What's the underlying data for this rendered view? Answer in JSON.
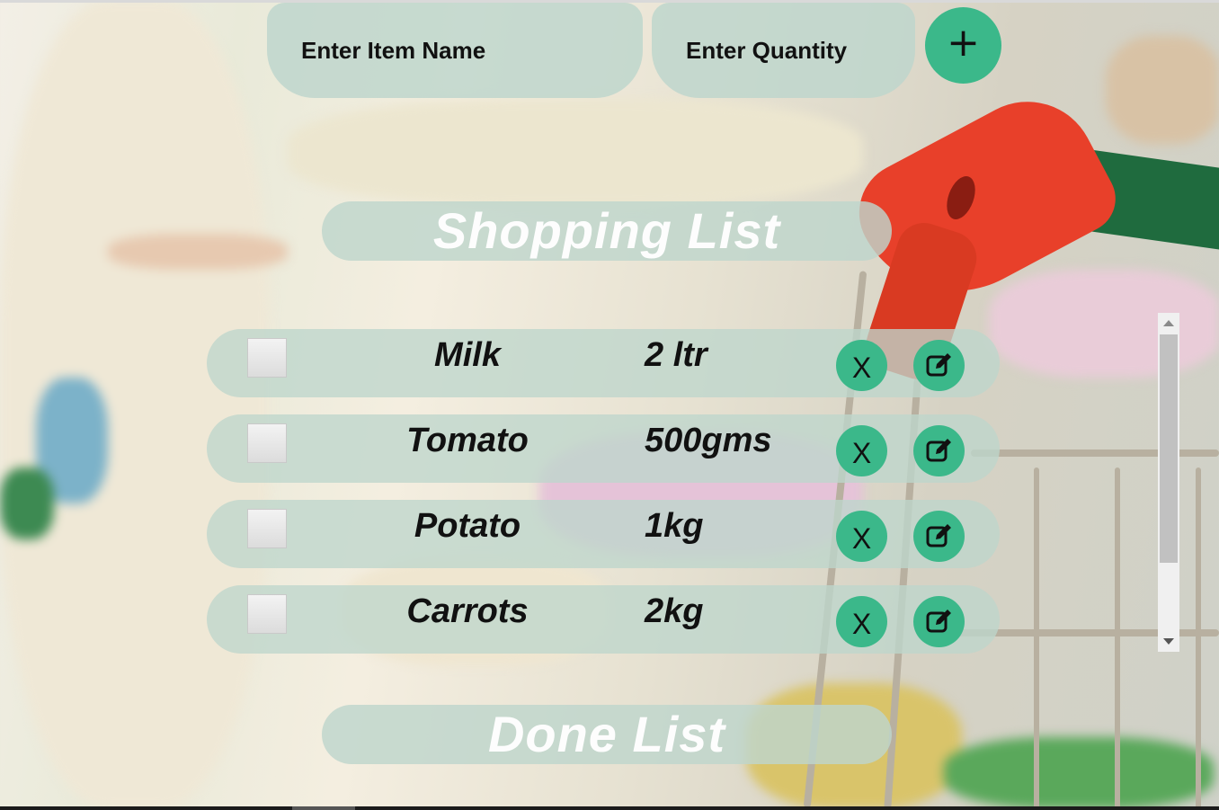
{
  "inputs": {
    "item_name_placeholder": "Enter Item Name",
    "quantity_placeholder": "Enter Quantity",
    "add_label": "+"
  },
  "shopping_title": "Shopping List",
  "done_title": "Done List",
  "items": [
    {
      "name": "Milk",
      "qty": "2 ltr",
      "checked": false
    },
    {
      "name": "Tomato",
      "qty": "500gms",
      "checked": false
    },
    {
      "name": "Potato",
      "qty": "1kg",
      "checked": false
    },
    {
      "name": "Carrots",
      "qty": "2kg",
      "checked": false
    }
  ],
  "row_actions": {
    "delete_label": "X",
    "edit_icon": "edit-icon"
  },
  "colors": {
    "accent": "#3bb88a",
    "pill": "#bed6cc"
  }
}
